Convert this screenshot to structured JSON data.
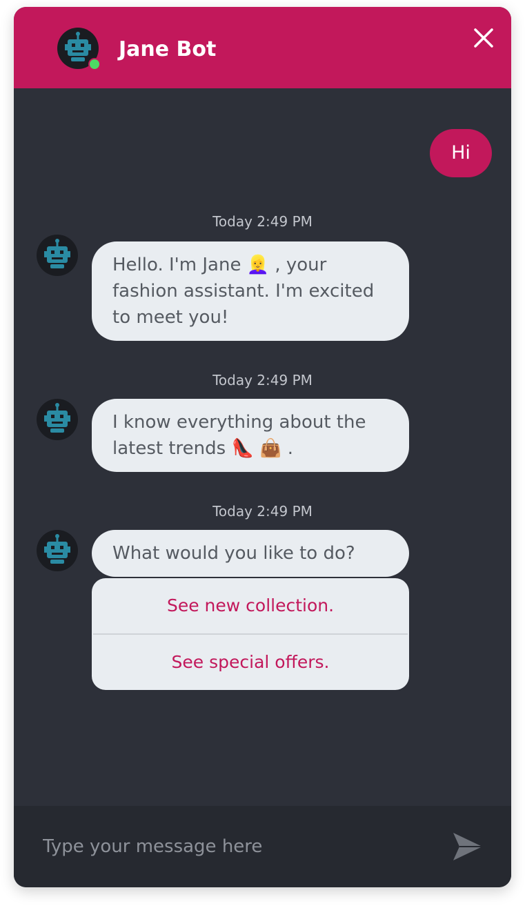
{
  "header": {
    "title": "Jane Bot",
    "avatar_icon": "robot-icon",
    "close_icon": "close-icon",
    "online_status_color": "#4cd964",
    "accent_color": "#c2185b"
  },
  "messages": [
    {
      "from": "user",
      "text": "Hi"
    },
    {
      "from": "bot",
      "timestamp": "Today 2:49 PM",
      "text": "Hello. I'm Jane 👱‍♀️ , your fashion assistant. I'm excited to meet you!"
    },
    {
      "from": "bot",
      "timestamp": "Today 2:49 PM",
      "text": "I know everything about the latest trends 👠 👜 ."
    },
    {
      "from": "bot",
      "timestamp": "Today 2:49 PM",
      "text": "What would you like to do?"
    }
  ],
  "quick_replies": [
    "See new collection.",
    "See special offers."
  ],
  "composer": {
    "placeholder": "Type your message here",
    "value": "",
    "send_icon": "send-icon"
  }
}
